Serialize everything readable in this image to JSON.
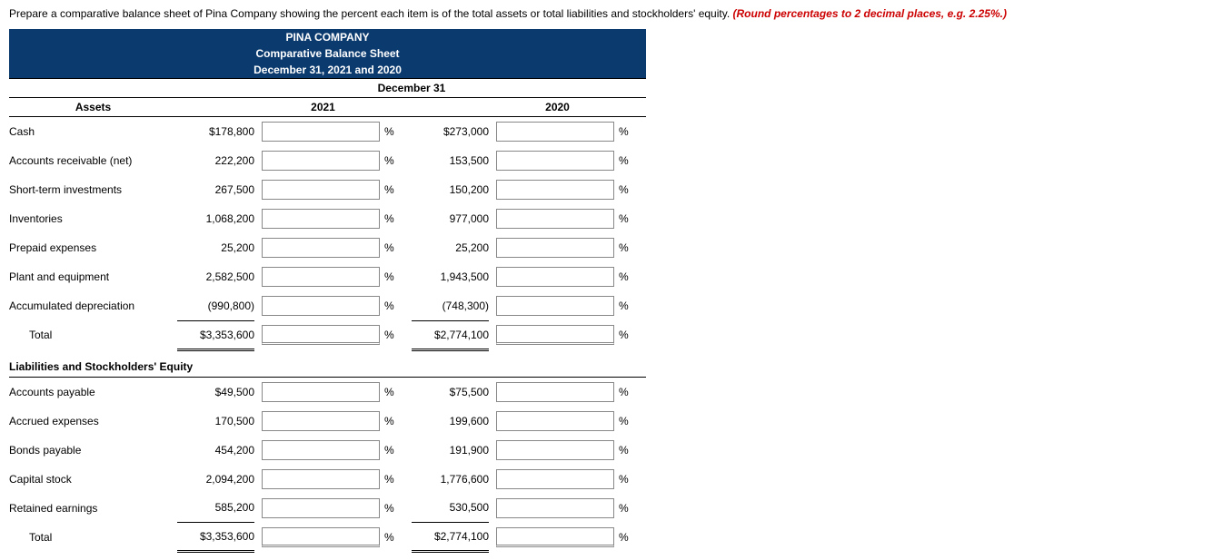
{
  "instruction": {
    "main": "Prepare a comparative balance sheet of Pina Company showing the percent each item is of the total assets or total liabilities and stockholders' equity. ",
    "hint": "(Round percentages to 2 decimal places, e.g. 2.25%.)"
  },
  "header": {
    "company": "PINA COMPANY",
    "title": "Comparative Balance Sheet",
    "dateline": "December 31, 2021 and 2020",
    "period": "December 31"
  },
  "years": {
    "y1": "2021",
    "y2": "2020"
  },
  "sections": {
    "assets_label": "Assets",
    "liab_label": "Liabilities and Stockholders' Equity"
  },
  "pct": "%",
  "rows": {
    "cash": {
      "label": "Cash",
      "a1": "$178,800",
      "a2": "$273,000"
    },
    "ar": {
      "label": "Accounts receivable (net)",
      "a1": "222,200",
      "a2": "153,500"
    },
    "stinv": {
      "label": "Short-term investments",
      "a1": "267,500",
      "a2": "150,200"
    },
    "inv": {
      "label": "Inventories",
      "a1": "1,068,200",
      "a2": "977,000"
    },
    "prepaid": {
      "label": "Prepaid expenses",
      "a1": "25,200",
      "a2": "25,200"
    },
    "plant": {
      "label": "Plant and equipment",
      "a1": "2,582,500",
      "a2": "1,943,500"
    },
    "accdep": {
      "label": "Accumulated depreciation",
      "a1": "(990,800)",
      "a2": "(748,300)"
    },
    "total_assets": {
      "label": "Total",
      "a1": "$3,353,600",
      "a2": "$2,774,100"
    },
    "ap": {
      "label": "Accounts payable",
      "a1": "$49,500",
      "a2": "$75,500"
    },
    "accrued": {
      "label": "Accrued expenses",
      "a1": "170,500",
      "a2": "199,600"
    },
    "bonds": {
      "label": "Bonds payable",
      "a1": "454,200",
      "a2": "191,900"
    },
    "capital": {
      "label": "Capital stock",
      "a1": "2,094,200",
      "a2": "1,776,600"
    },
    "retained": {
      "label": "Retained earnings",
      "a1": "585,200",
      "a2": "530,500"
    },
    "total_liab": {
      "label": "Total",
      "a1": "$3,353,600",
      "a2": "$2,774,100"
    }
  }
}
